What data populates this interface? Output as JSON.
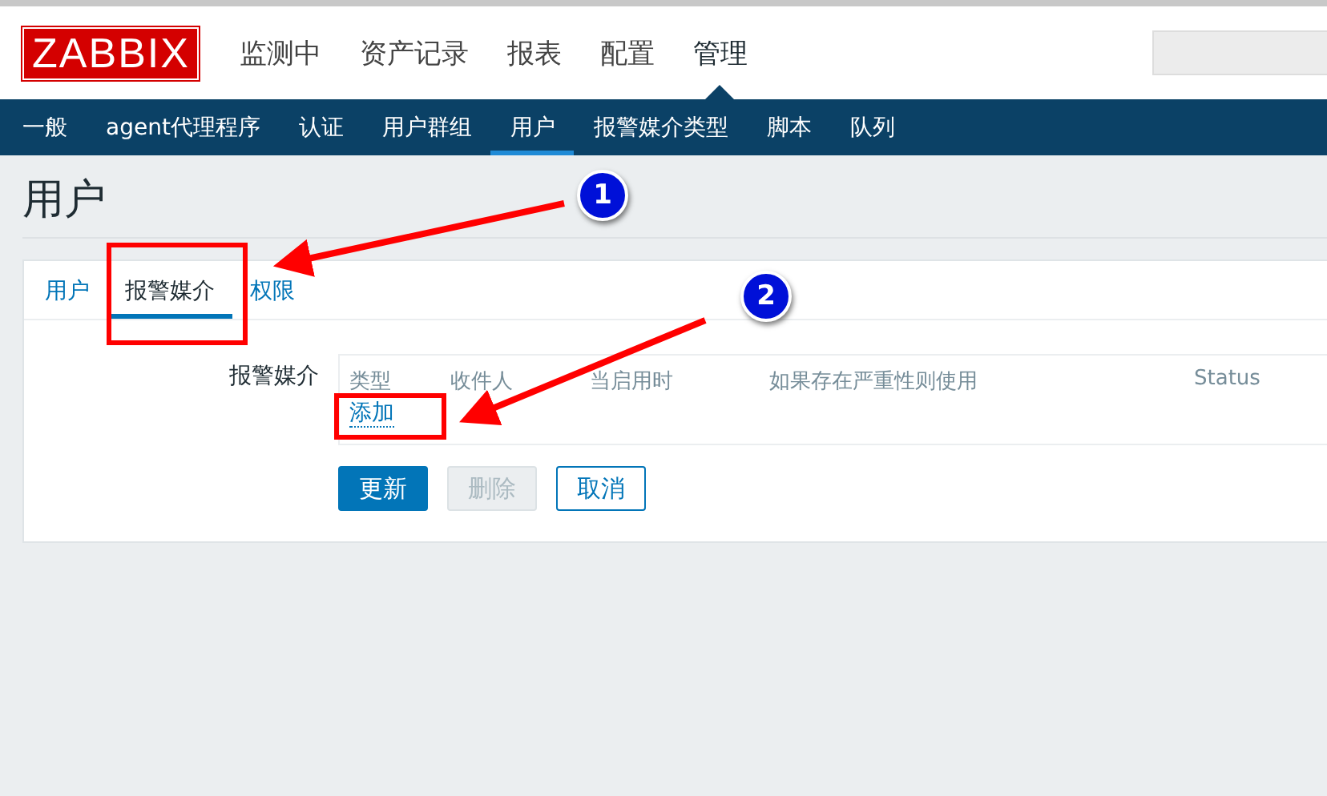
{
  "header": {
    "logo": "ZABBIX",
    "menu": [
      {
        "label": "监测中",
        "selected": false
      },
      {
        "label": "资产记录",
        "selected": false
      },
      {
        "label": "报表",
        "selected": false
      },
      {
        "label": "配置",
        "selected": false
      },
      {
        "label": "管理",
        "selected": true
      }
    ]
  },
  "submenu": [
    {
      "label": "一般",
      "selected": false
    },
    {
      "label": "agent代理程序",
      "selected": false
    },
    {
      "label": "认证",
      "selected": false
    },
    {
      "label": "用户群组",
      "selected": false
    },
    {
      "label": "用户",
      "selected": true
    },
    {
      "label": "报警媒介类型",
      "selected": false
    },
    {
      "label": "脚本",
      "selected": false
    },
    {
      "label": "队列",
      "selected": false
    }
  ],
  "page_title": "用户",
  "tabs": [
    {
      "label": "用户",
      "selected": false
    },
    {
      "label": "报警媒介",
      "selected": true
    },
    {
      "label": "权限",
      "selected": false
    }
  ],
  "media": {
    "label": "报警媒介",
    "columns": [
      "类型",
      "收件人",
      "当启用时",
      "如果存在严重性则使用",
      "Status"
    ],
    "add_link": "添加"
  },
  "buttons": [
    {
      "label": "更新",
      "kind": "primary",
      "disabled": false
    },
    {
      "label": "删除",
      "kind": "secondary",
      "disabled": true
    },
    {
      "label": "取消",
      "kind": "secondary",
      "disabled": false
    }
  ],
  "annotations": [
    {
      "number": "1"
    },
    {
      "number": "2"
    }
  ]
}
